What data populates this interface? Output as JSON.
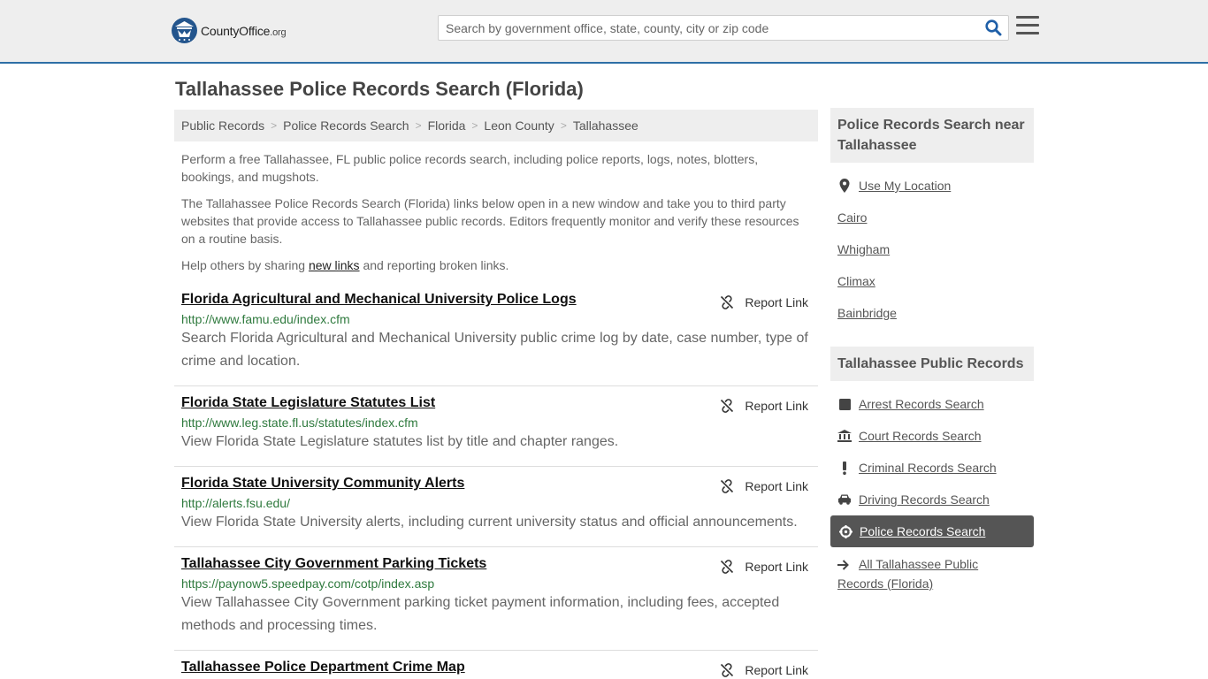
{
  "header": {
    "logo_name": "CountyOffice",
    "logo_tld": ".org",
    "search_placeholder": "Search by government office, state, county, city or zip code"
  },
  "page": {
    "title": "Tallahassee Police Records Search (Florida)"
  },
  "breadcrumb": [
    "Public Records",
    "Police Records Search",
    "Florida",
    "Leon County",
    "Tallahassee"
  ],
  "intro": {
    "p1": "Perform a free Tallahassee, FL public police records search, including police reports, logs, notes, blotters, bookings, and mugshots.",
    "p2": "The Tallahassee Police Records Search (Florida) links below open in a new window and take you to third party websites that provide access to Tallahassee public records. Editors frequently monitor and verify these resources on a routine basis.",
    "p3_before": "Help others by sharing ",
    "p3_link": "new links",
    "p3_after": " and reporting broken links."
  },
  "report_label": "Report Link",
  "results": [
    {
      "title": "Florida Agricultural and Mechanical University Police Logs",
      "url": "http://www.famu.edu/index.cfm",
      "desc": "Search Florida Agricultural and Mechanical University public crime log by date, case number, type of crime and location."
    },
    {
      "title": "Florida State Legislature Statutes List",
      "url": "http://www.leg.state.fl.us/statutes/index.cfm",
      "desc": "View Florida State Legislature statutes list by title and chapter ranges."
    },
    {
      "title": "Florida State University Community Alerts",
      "url": "http://alerts.fsu.edu/",
      "desc": "View Florida State University alerts, including current university status and official announcements."
    },
    {
      "title": "Tallahassee City Government Parking Tickets",
      "url": "https://paynow5.speedpay.com/cotp/index.asp",
      "desc": "View Tallahassee City Government parking ticket payment information, including fees, accepted methods and processing times."
    },
    {
      "title": "Tallahassee Police Department Crime Map",
      "url": "",
      "desc": ""
    }
  ],
  "sidebar": {
    "nearby_heading": "Police Records Search near Tallahassee",
    "use_location": "Use My Location",
    "nearby": [
      "Cairo",
      "Whigham",
      "Climax",
      "Bainbridge"
    ],
    "public_heading": "Tallahassee Public Records",
    "records": [
      {
        "label": "Arrest Records Search",
        "icon": "square-icon"
      },
      {
        "label": "Court Records Search",
        "icon": "courthouse-icon"
      },
      {
        "label": "Criminal Records Search",
        "icon": "exclamation-icon"
      },
      {
        "label": "Driving Records Search",
        "icon": "car-icon"
      }
    ],
    "active": {
      "label": "Police Records Search",
      "icon": "crosshair-icon"
    },
    "all_label": "All Tallahassee Public Records (Florida)"
  },
  "colors": {
    "header_bg": "#eeeeee",
    "header_border": "#2e6fa6",
    "logo_blue": "#23558d",
    "url_green": "#2f7a3e",
    "search_icon_blue": "#1f5fa8",
    "active_bg": "#555555"
  }
}
